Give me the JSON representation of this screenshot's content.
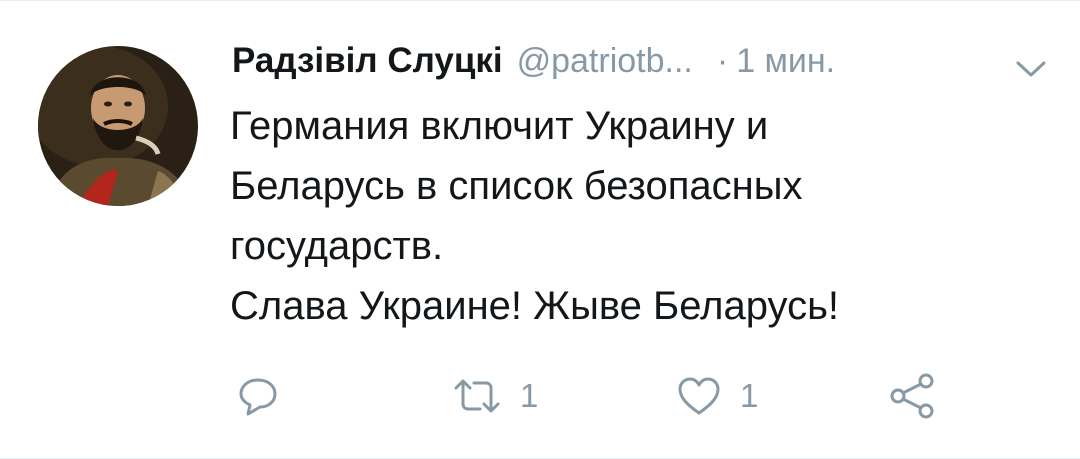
{
  "tweet": {
    "author_name": "Радзівіл Слуцкі",
    "handle": "@patriotb...",
    "separator": "·",
    "time": "1 мин.",
    "text_lines": [
      "Германия включит Украину и",
      "Беларусь в список безопасных",
      "государств.",
      "Слава Украине! Жыве Беларусь!"
    ],
    "retweet_count": "1",
    "like_count": "1"
  },
  "icons": {
    "menu": "chevron-down-icon",
    "reply": "reply-icon",
    "retweet": "retweet-icon",
    "like": "heart-icon",
    "share": "share-icon"
  },
  "colors": {
    "text": "#14171a",
    "secondary": "#8899a6",
    "divider": "#e6ecf0"
  }
}
